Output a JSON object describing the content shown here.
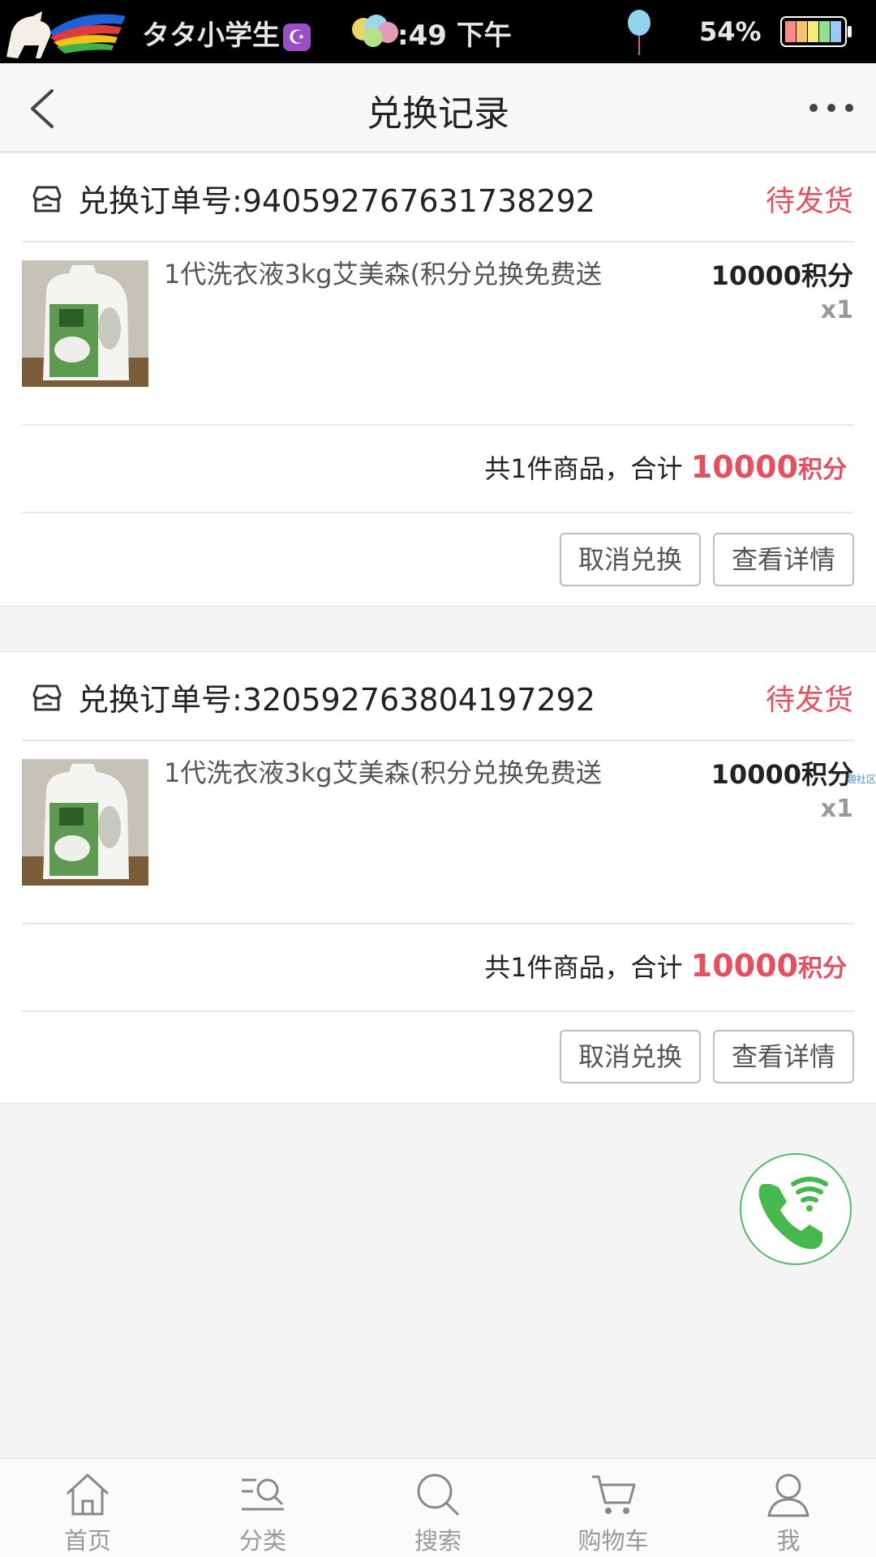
{
  "status_bar": {
    "username": "タタ小学生",
    "moon_glyph": "☪",
    "time": ":49 下午",
    "battery_percent": "54%"
  },
  "header": {
    "title": "兑换记录",
    "back_icon": "chevron-left-icon",
    "more_icon": "more-dots-icon"
  },
  "orders": [
    {
      "order_label": "兑换订单号:940592767631738292",
      "status": "待发货",
      "product_name": "1代洗衣液3kg艾美森(积分兑换免费送",
      "price": "10000积分",
      "qty": "x1",
      "total_prefix": "共1件商品，合计 ",
      "total_points": "10000",
      "total_unit": "积分",
      "cancel_label": "取消兑换",
      "detail_label": "查看详情"
    },
    {
      "order_label": "兑换订单号:320592763804197292",
      "status": "待发货",
      "product_name": "1代洗衣液3kg艾美森(积分兑换免费送",
      "price": "10000积分",
      "qty": "x1",
      "total_prefix": "共1件商品，合计 ",
      "total_points": "10000",
      "total_unit": "积分",
      "cancel_label": "取消兑换",
      "detail_label": "查看详情"
    }
  ],
  "watermark": "趣社区",
  "tabbar": [
    {
      "label": "首页",
      "icon": "home-icon"
    },
    {
      "label": "分类",
      "icon": "category-icon"
    },
    {
      "label": "搜索",
      "icon": "search-icon"
    },
    {
      "label": "购物车",
      "icon": "cart-icon"
    },
    {
      "label": "我",
      "icon": "user-icon"
    }
  ],
  "colors": {
    "accent_red": "#e5505f",
    "call_green": "#56b86a"
  }
}
